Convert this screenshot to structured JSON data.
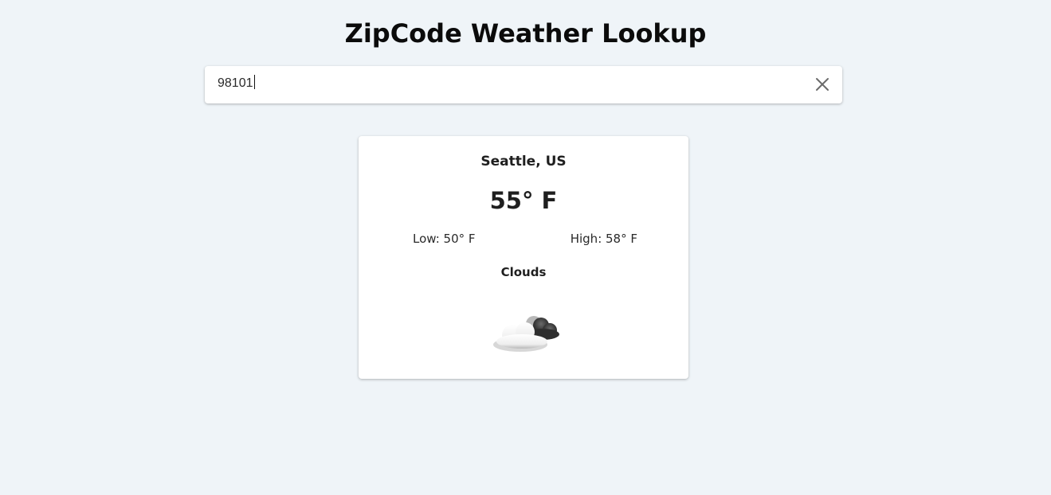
{
  "header": {
    "title": "ZipCode Weather Lookup"
  },
  "search": {
    "value": "98101",
    "clear_icon": "close-icon"
  },
  "weather": {
    "location": "Seattle, US",
    "temperature": "55° F",
    "low": "Low: 50° F",
    "high": "High: 58° F",
    "condition": "Clouds",
    "icon": "cloud-icon"
  },
  "colors": {
    "background": "#eff4f8",
    "card": "#ffffff"
  }
}
